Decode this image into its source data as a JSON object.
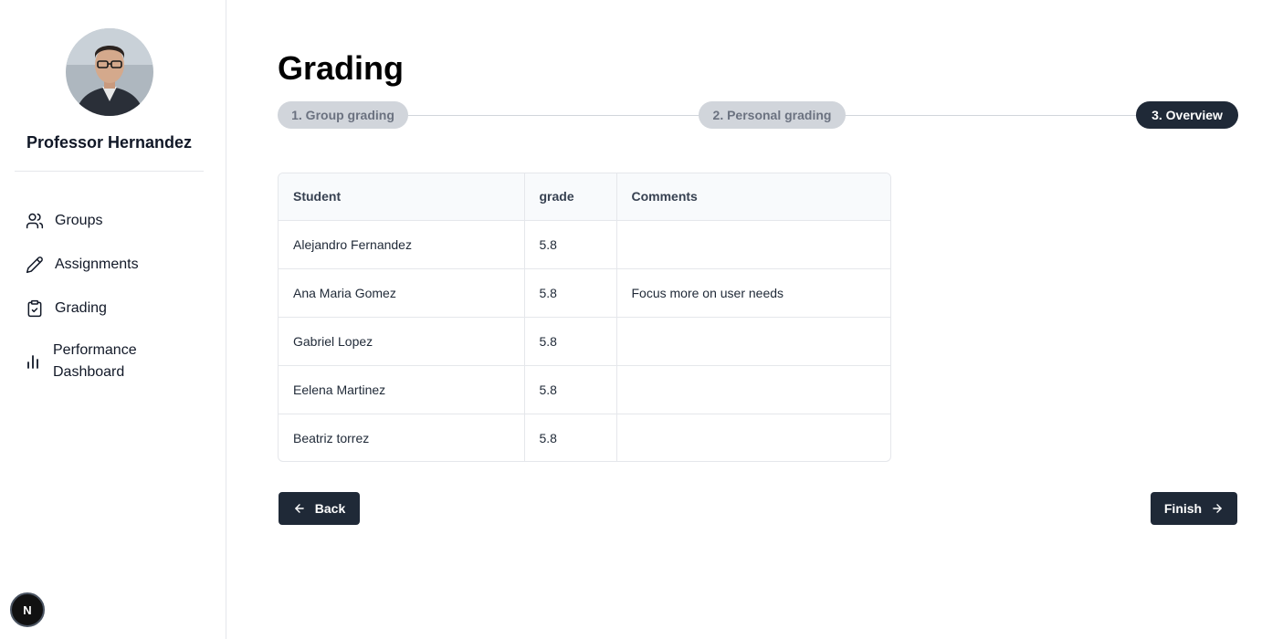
{
  "sidebar": {
    "profile_name": "Professor Hernandez",
    "items": [
      {
        "label": "Groups",
        "icon": "users-icon"
      },
      {
        "label": "Assignments",
        "icon": "pencil-icon"
      },
      {
        "label": "Grading",
        "icon": "clipboard-check-icon"
      },
      {
        "label": "Performance Dashboard",
        "icon": "bar-chart-icon"
      }
    ],
    "badge_letter": "N"
  },
  "page": {
    "title": "Grading"
  },
  "stepper": {
    "steps": [
      {
        "label": "1. Group grading",
        "state": "inactive"
      },
      {
        "label": "2. Personal grading",
        "state": "inactive"
      },
      {
        "label": "3. Overview",
        "state": "active"
      }
    ]
  },
  "table": {
    "headers": [
      "Student",
      "grade",
      "Comments"
    ],
    "rows": [
      {
        "student": "Alejandro Fernandez",
        "grade": "5.8",
        "comment": ""
      },
      {
        "student": "Ana Maria Gomez",
        "grade": "5.8",
        "comment": "Focus more on user needs"
      },
      {
        "student": "Gabriel Lopez",
        "grade": "5.8",
        "comment": ""
      },
      {
        "student": "Eelena Martinez",
        "grade": "5.8",
        "comment": ""
      },
      {
        "student": "Beatriz torrez",
        "grade": "5.8",
        "comment": ""
      }
    ]
  },
  "actions": {
    "back_label": "Back",
    "finish_label": "Finish"
  },
  "colors": {
    "primary": "#1f2937",
    "step_inactive": "#d1d5db",
    "border": "#e5e7eb",
    "header_bg": "#f8fafc"
  }
}
